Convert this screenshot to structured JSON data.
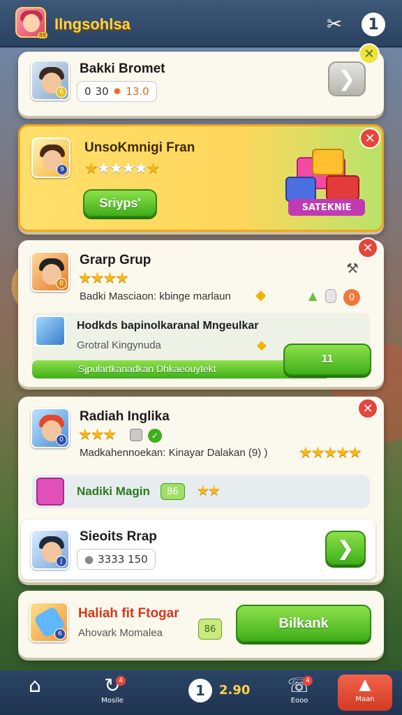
{
  "app": {
    "title": "Ilngsohlsa",
    "avatar_tag": "88"
  },
  "header": {
    "scissors_icon": "scissors-icon",
    "info_glyph": "1"
  },
  "card1": {
    "name": "Bakki Bromet",
    "value_prefix": "0",
    "value_main": "30",
    "value_extra": "13.0",
    "badge": "6",
    "close": "✕"
  },
  "promo": {
    "name": "UnsoKmnigi Fran",
    "rating": 3,
    "rating_max": 6,
    "button": "Sriyps'",
    "gift_label": "SATEKNIE",
    "badge": "9",
    "close": "✕"
  },
  "group": {
    "name": "Grarp Grup",
    "rating": 4,
    "line": "Badki Masciaon: kbinge marlaun",
    "task": "Hodkds bapinolkaranal Mngeulkar",
    "task_sub": "Grotral Kingynuda",
    "progress_text": "Sjpulartkanadkan Dhkaeouytekt",
    "progress": 0.88,
    "action": "11",
    "count": "0",
    "pic_badge": "0",
    "close": "✕"
  },
  "radiah": {
    "name": "Radiah Inglika",
    "rating": 3,
    "line": "Madkahennoekan: Kinayar Dalakan",
    "line_tail": "(9) )",
    "gift_row": "Nadiki Magin",
    "gift_badge": "86",
    "pic_badge": "0",
    "close": "✕"
  },
  "friend": {
    "name": "Sieoits Rrap",
    "value": "3333 150",
    "pic_badge": "J"
  },
  "reward": {
    "name": "Haliah fit Ftogar",
    "sub": "Ahovark Momalea",
    "chip": "86",
    "button": "Bilkank",
    "pic_badge": "6"
  },
  "bottom_nav": {
    "home": "",
    "refresh_label": "Mosile",
    "refresh_dot": "4",
    "center_glyph": "1",
    "score": "2.90",
    "chat_label": "Eooo",
    "chat_dot": "4",
    "last_label": "Maan"
  },
  "colors": {
    "accent_green": "#3faf1a",
    "close_red": "#e8443a",
    "title_gold": "#ffd24a"
  }
}
